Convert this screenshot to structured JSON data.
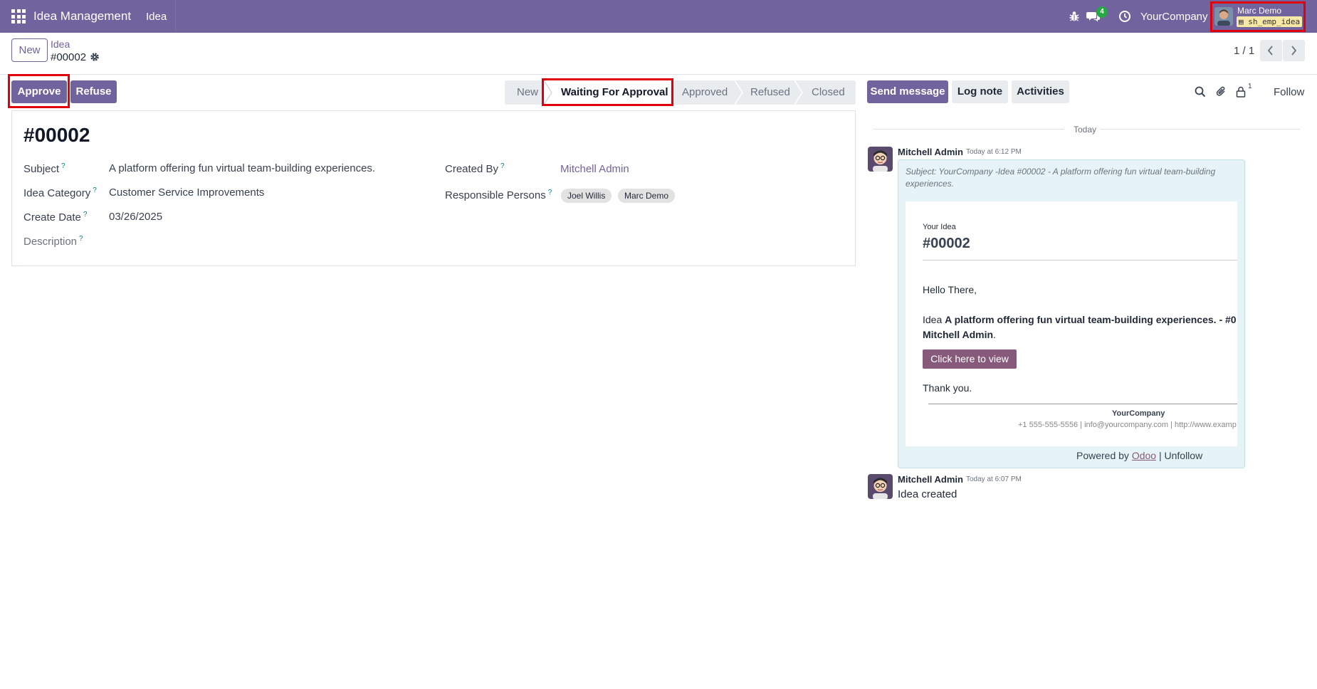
{
  "navbar": {
    "app_name": "Idea Management",
    "menu_idea": "Idea",
    "chat_count": "4",
    "company": "YourCompany",
    "user_name": "Marc Demo",
    "user_db": "sh_emp_idea"
  },
  "control": {
    "new_label": "New",
    "breadcrumb_parent": "Idea",
    "breadcrumb_current": "#00002",
    "pager_value": "1 / 1"
  },
  "statusbar": {
    "approve_label": "Approve",
    "refuse_label": "Refuse",
    "stages": [
      "New",
      "Waiting For Approval",
      "Approved",
      "Refused",
      "Closed"
    ],
    "active_stage": "Waiting For Approval"
  },
  "form": {
    "title": "#00002",
    "fields": {
      "subject_label": "Subject",
      "subject_value": "A platform offering fun virtual team-building experiences.",
      "category_label": "Idea Category",
      "category_value": "Customer Service Improvements",
      "create_date_label": "Create Date",
      "create_date_value": "03/26/2025",
      "description_label": "Description",
      "created_by_label": "Created By",
      "created_by_value": "Mitchell Admin",
      "responsible_label": "Responsible Persons",
      "responsible_tags": [
        "Joel Willis",
        "Marc Demo"
      ]
    },
    "help_marker": "?"
  },
  "chatter": {
    "send_message": "Send message",
    "log_note": "Log note",
    "activities": "Activities",
    "follower_count": "1",
    "follow": "Follow",
    "today": "Today",
    "messages": [
      {
        "author": "Mitchell Admin",
        "date": "Today at 6:12 PM",
        "subject": "Subject: YourCompany -Idea #00002 - A platform offering fun virtual team-building experiences.",
        "mail": {
          "kicker": "Your Idea",
          "title": "#00002",
          "greeting": "Hello There,",
          "line_prefix": "Idea ",
          "line_bold": "A platform offering fun virtual team-building experiences.",
          "line_suffix": " - #0",
          "line2_bold": "Mitchell Admin",
          "line2_suffix": ".",
          "button": "Click here to view",
          "thanks": "Thank you.",
          "company": "YourCompany",
          "contact": "+1 555-555-5556 | info@yourcompany.com | http://www.examp"
        },
        "powered_prefix": "Powered by ",
        "powered_link": "Odoo",
        "powered_suffix": " | Unfollow"
      },
      {
        "author": "Mitchell Admin",
        "date": "Today at 6:07 PM",
        "body": "Idea created"
      }
    ]
  },
  "colors": {
    "brand": "#71639e",
    "highlight": "#e0000b",
    "mail_button": "#875a7b"
  }
}
